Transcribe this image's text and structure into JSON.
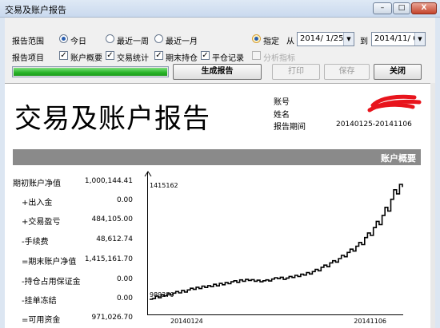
{
  "window": {
    "title": "交易及账户报告",
    "min": "–",
    "max": "□",
    "close": "X"
  },
  "controls": {
    "range_label": "报告范围",
    "range_options": [
      "今日",
      "最近一周",
      "最近一月",
      "指定"
    ],
    "from_label": "从",
    "to_label": "到",
    "from_date": "2014/ 1/25",
    "to_date": "2014/11/ 6",
    "items_label": "报告项目",
    "items": [
      "账户概要",
      "交易统计",
      "期末持仓",
      "平仓记录"
    ],
    "disabled_item": "分析指标",
    "progress": 1.0
  },
  "buttons": {
    "generate": "生成报告",
    "print": "打印",
    "save": "保存",
    "close": "关闭"
  },
  "report": {
    "title": "交易及账户报告",
    "account_label": "账号",
    "name_label": "姓名",
    "period_label": "报告期间",
    "period_value": "20140125-20141106",
    "section_title": "账户概要",
    "rows": [
      {
        "label": "期初账户净值",
        "value": "1,000,144.41"
      },
      {
        "label": "+出入金",
        "value": "0.00"
      },
      {
        "label": "+交易盈亏",
        "value": "484,105.00"
      },
      {
        "label": "-手续费",
        "value": "48,612.74"
      },
      {
        "label": "=期末账户净值",
        "value": "1,415,161.70"
      },
      {
        "label": "-持仓占用保证金",
        "value": "0.00"
      },
      {
        "label": "-挂单冻结",
        "value": "0.00"
      },
      {
        "label": "=可用资金",
        "value": "971,026.70"
      }
    ]
  },
  "chart_data": {
    "type": "line",
    "x_start_label": "20140124",
    "x_end_label": "20141106",
    "y_max_label": "1415162",
    "y_min_label": "989279",
    "ylim": [
      989279,
      1415162
    ],
    "values": [
      989279,
      992000,
      1001000,
      995000,
      1006000,
      1002000,
      1010000,
      1005000,
      1012000,
      1018000,
      1013000,
      1022000,
      1016000,
      1024000,
      1030000,
      1026000,
      1034000,
      1029000,
      1038000,
      1033000,
      1040000,
      1036000,
      1045000,
      1039000,
      1048000,
      1043000,
      1051000,
      1047000,
      1054000,
      1058000,
      1052000,
      1061000,
      1056000,
      1063000,
      1059000,
      1062000,
      1056000,
      1060000,
      1054000,
      1058000,
      1061000,
      1057000,
      1064000,
      1069000,
      1066000,
      1071000,
      1063000,
      1068000,
      1074000,
      1070000,
      1078000,
      1074000,
      1082000,
      1079000,
      1088000,
      1083000,
      1092000,
      1100000,
      1095000,
      1108000,
      1116000,
      1110000,
      1124000,
      1132000,
      1127000,
      1140000,
      1152000,
      1147000,
      1163000,
      1175000,
      1168000,
      1186000,
      1200000,
      1192000,
      1218000,
      1235000,
      1226000,
      1255000,
      1278000,
      1266000,
      1300000,
      1330000,
      1316000,
      1360000,
      1395000,
      1380000,
      1415162,
      1405000
    ]
  }
}
